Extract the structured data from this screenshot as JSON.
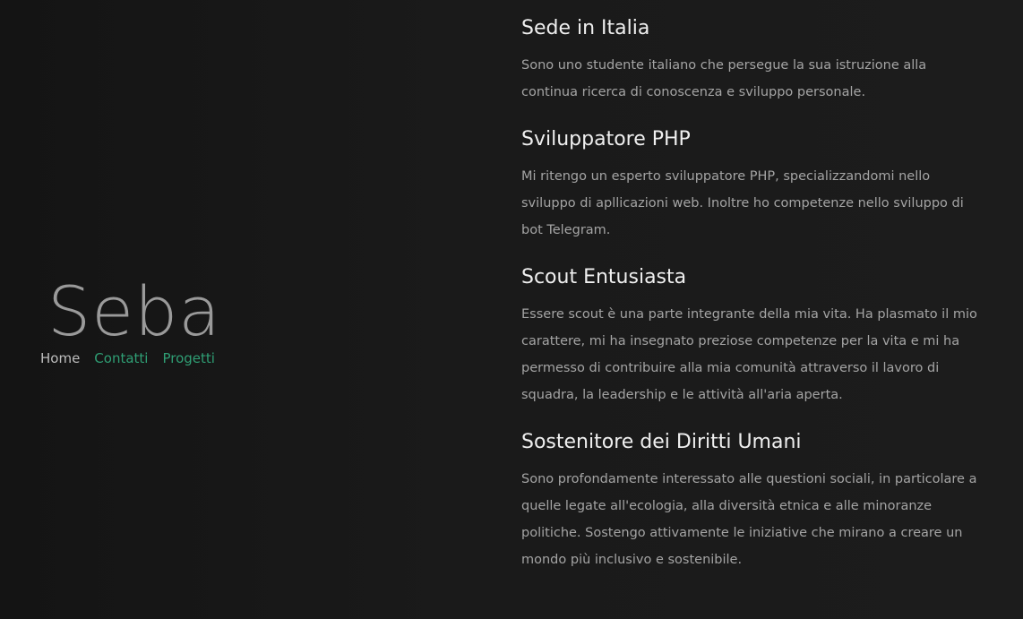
{
  "brand": {
    "name": "Seba"
  },
  "nav": {
    "home": "Home",
    "contatti": "Contatti",
    "progetti": "Progetti"
  },
  "colors": {
    "background": "#1c1c1c",
    "accent": "#2f9e74",
    "heading": "#efefef",
    "body_text": "#a4a4a4"
  },
  "sections": [
    {
      "title": "Sede in Italia",
      "text": "Sono uno studente italiano che persegue la sua istruzione alla continua ricerca di conoscenza e sviluppo personale."
    },
    {
      "title": "Sviluppatore PHP",
      "text": "Mi ritengo un esperto sviluppatore PHP, specializzandomi nello sviluppo di apllicazioni web. Inoltre ho competenze nello sviluppo di bot Telegram."
    },
    {
      "title": "Scout Entusiasta",
      "text": "Essere scout è una parte integrante della mia vita. Ha plasmato il mio carattere, mi ha insegnato preziose competenze per la vita e mi ha permesso di contribuire alla mia comunità attraverso il lavoro di squadra, la leadership e le attività all'aria aperta."
    },
    {
      "title": "Sostenitore dei Diritti Umani",
      "text": "Sono profondamente interessato alle questioni sociali, in particolare a quelle legate all'ecologia, alla diversità etnica e alle minoranze politiche. Sostengo attivamente le iniziative che mirano a creare un mondo più inclusivo e sostenibile."
    }
  ]
}
